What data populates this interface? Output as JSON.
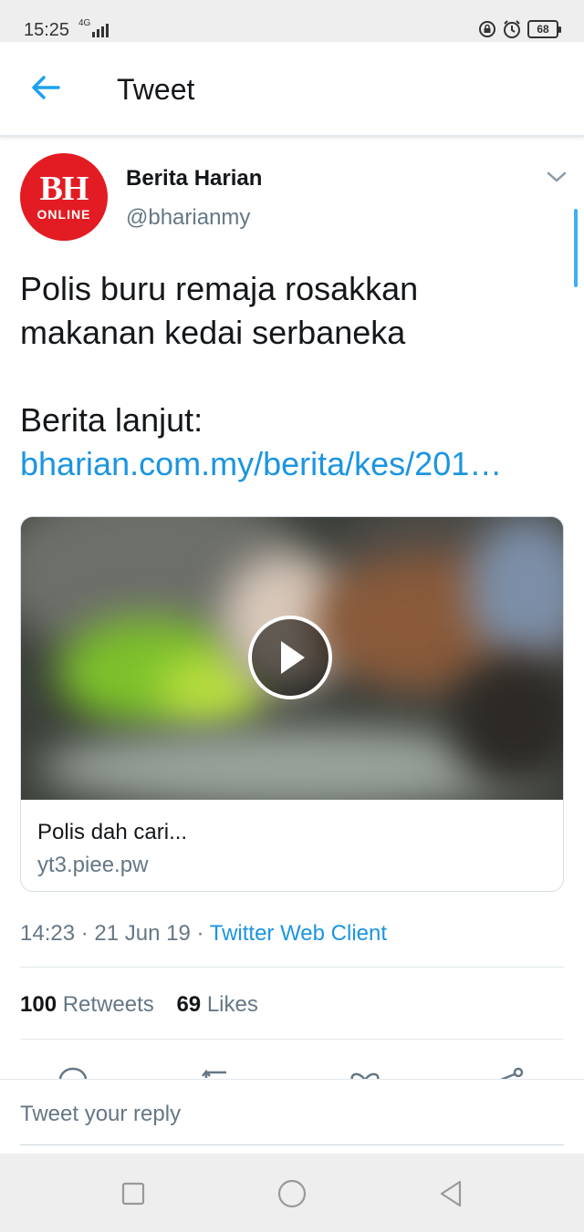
{
  "status_bar": {
    "time": "15:25",
    "network": "4G",
    "battery": "68"
  },
  "header": {
    "title": "Tweet"
  },
  "tweet": {
    "avatar": {
      "line1": "BH",
      "line2": "ONLINE",
      "color": "#e31b23"
    },
    "user_name": "Berita Harian",
    "user_handle": "@bharianmy",
    "text_lines": [
      "Polis buru remaja rosakkan",
      "makanan kedai serbaneka"
    ],
    "more_label": "Berita lanjut:",
    "link": "bharian.com.my/berita/kes/201…",
    "card": {
      "title": "Polis dah cari...",
      "domain": "yt3.piee.pw"
    },
    "meta": {
      "time": "14:23",
      "date": "21 Jun 19",
      "client": "Twitter Web Client",
      "separator": "·"
    },
    "stats": {
      "retweets_count": "100",
      "retweets_label": "Retweets",
      "likes_count": "69",
      "likes_label": "Likes"
    },
    "actions": [
      "reply-icon",
      "retweet-icon",
      "like-icon",
      "share-icon"
    ]
  },
  "reply": {
    "placeholder": "Tweet your reply"
  },
  "nav": {
    "buttons": [
      "recents-icon",
      "home-icon",
      "back-icon"
    ]
  },
  "colors": {
    "accent": "#1da1f2",
    "link": "#1b95e0",
    "secondary_text": "#657786",
    "status_bar_bg": "#eeeeee"
  }
}
